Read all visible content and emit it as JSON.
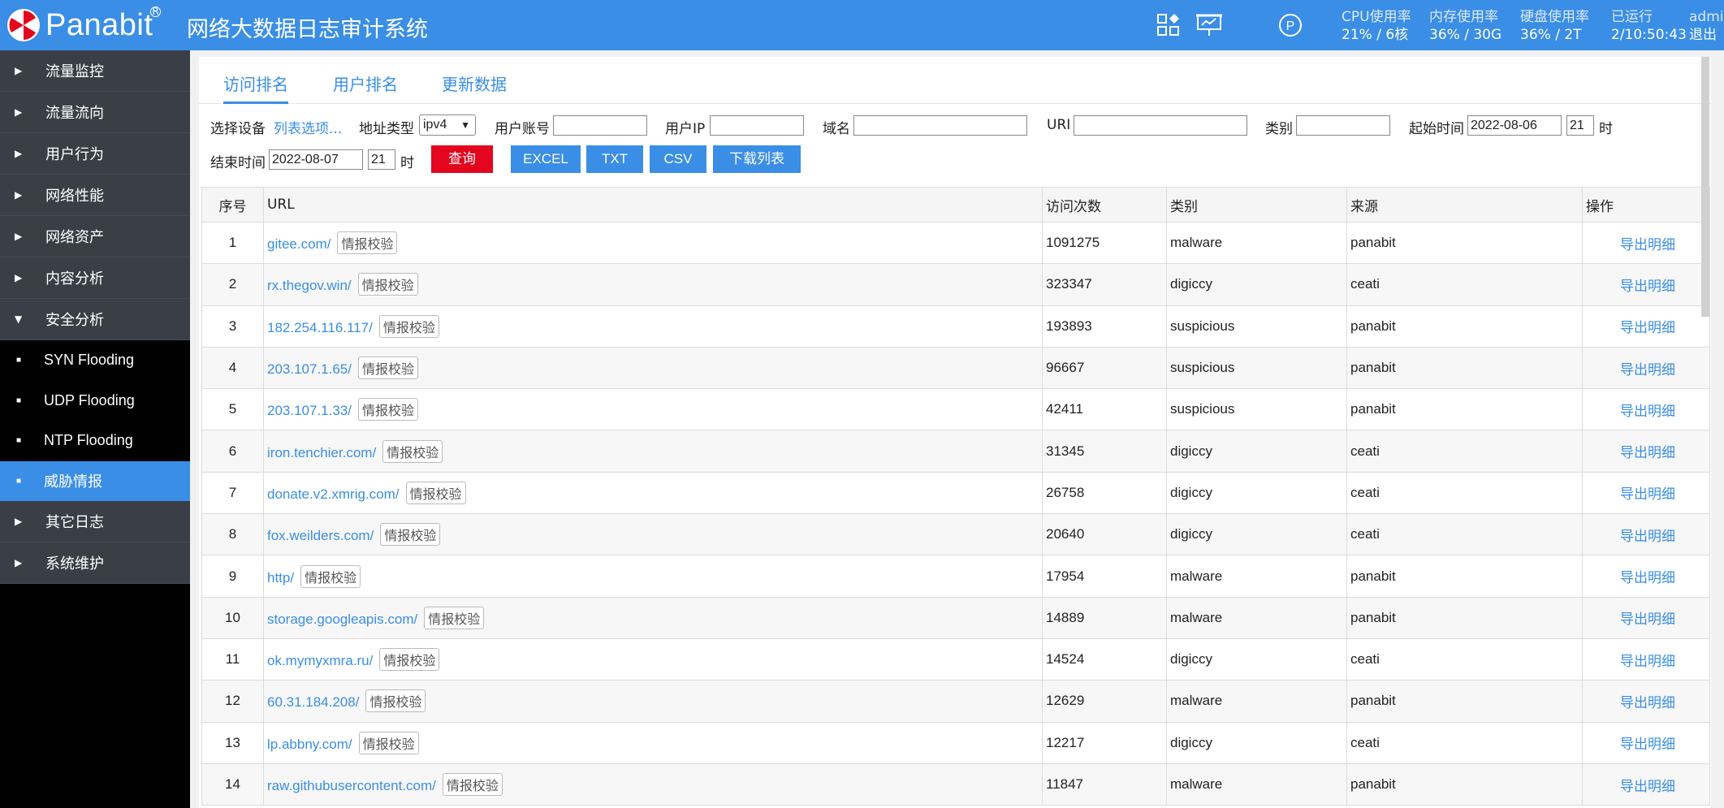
{
  "header": {
    "brand": "Panabit",
    "reg": "R",
    "title": "网络大数据日志审计系统",
    "stats": [
      {
        "label": "CPU使用率",
        "value": "21% / 6核"
      },
      {
        "label": "内存使用率",
        "value": "36% / 30G"
      },
      {
        "label": "硬盘使用率",
        "value": "36% / 2T"
      },
      {
        "label": "已运行",
        "value": "2/10:50:43"
      }
    ],
    "user": "admin",
    "logout": "退出"
  },
  "sidebar": {
    "items": [
      {
        "label": "流量监控"
      },
      {
        "label": "流量流向"
      },
      {
        "label": "用户行为"
      },
      {
        "label": "网络性能"
      },
      {
        "label": "网络资产"
      },
      {
        "label": "内容分析"
      },
      {
        "label": "安全分析"
      }
    ],
    "sub_items": [
      {
        "label": "SYN Flooding"
      },
      {
        "label": "UDP Flooding"
      },
      {
        "label": "NTP Flooding"
      },
      {
        "label": "威胁情报"
      }
    ],
    "items_after": [
      {
        "label": "其它日志"
      },
      {
        "label": "系统维护"
      }
    ]
  },
  "tabs": [
    {
      "label": "访问排名"
    },
    {
      "label": "用户排名"
    },
    {
      "label": "更新数据"
    }
  ],
  "filters": {
    "device_label": "选择设备",
    "device_link": "列表选项...",
    "addr_type_label": "地址类型",
    "addr_type_value": "ipv4",
    "user_account_label": "用户账号",
    "user_ip_label": "用户IP",
    "domain_label": "域名",
    "uri_label": "URI",
    "category_label": "类别",
    "start_label": "起始时间",
    "start_date": "2022-08-06",
    "start_hour": "21",
    "hour_unit": "时",
    "end_label": "结束时间",
    "end_date": "2022-08-07",
    "end_hour": "21"
  },
  "buttons": {
    "query": "查询",
    "excel": "EXCEL",
    "txt": "TXT",
    "csv": "CSV",
    "download": "下载列表"
  },
  "table": {
    "headers": [
      "序号",
      "URL",
      "访问次数",
      "类别",
      "来源",
      "操作"
    ],
    "verify_label": "情报校验",
    "op_label": "导出明细",
    "rows": [
      {
        "idx": "1",
        "url": "gitee.com/",
        "count": "1091275",
        "category": "malware",
        "source": "panabit"
      },
      {
        "idx": "2",
        "url": "rx.thegov.win/",
        "count": "323347",
        "category": "digiccy",
        "source": "ceati"
      },
      {
        "idx": "3",
        "url": "182.254.116.117/",
        "count": "193893",
        "category": "suspicious",
        "source": "panabit"
      },
      {
        "idx": "4",
        "url": "203.107.1.65/",
        "count": "96667",
        "category": "suspicious",
        "source": "panabit"
      },
      {
        "idx": "5",
        "url": "203.107.1.33/",
        "count": "42411",
        "category": "suspicious",
        "source": "panabit"
      },
      {
        "idx": "6",
        "url": "iron.tenchier.com/",
        "count": "31345",
        "category": "digiccy",
        "source": "ceati"
      },
      {
        "idx": "7",
        "url": "donate.v2.xmrig.com/",
        "count": "26758",
        "category": "digiccy",
        "source": "ceati"
      },
      {
        "idx": "8",
        "url": "fox.weilders.com/",
        "count": "20640",
        "category": "digiccy",
        "source": "ceati"
      },
      {
        "idx": "9",
        "url": "http/",
        "count": "17954",
        "category": "malware",
        "source": "panabit"
      },
      {
        "idx": "10",
        "url": "storage.googleapis.com/",
        "count": "14889",
        "category": "malware",
        "source": "panabit"
      },
      {
        "idx": "11",
        "url": "ok.mymyxmra.ru/",
        "count": "14524",
        "category": "digiccy",
        "source": "ceati"
      },
      {
        "idx": "12",
        "url": "60.31.184.208/",
        "count": "12629",
        "category": "malware",
        "source": "panabit"
      },
      {
        "idx": "13",
        "url": "lp.abbny.com/",
        "count": "12217",
        "category": "digiccy",
        "source": "ceati"
      },
      {
        "idx": "14",
        "url": "raw.githubusercontent.com/",
        "count": "11847",
        "category": "malware",
        "source": "panabit"
      }
    ]
  },
  "icons": {
    "logo": "panabit-logo-icon",
    "apps": "apps-grid-icon",
    "presentation": "presentation-icon",
    "p_badge": "p-circle-icon"
  },
  "colors": {
    "accent": "#3a8ee6",
    "danger": "#e4061e",
    "sidebar": "#3a3f47"
  }
}
